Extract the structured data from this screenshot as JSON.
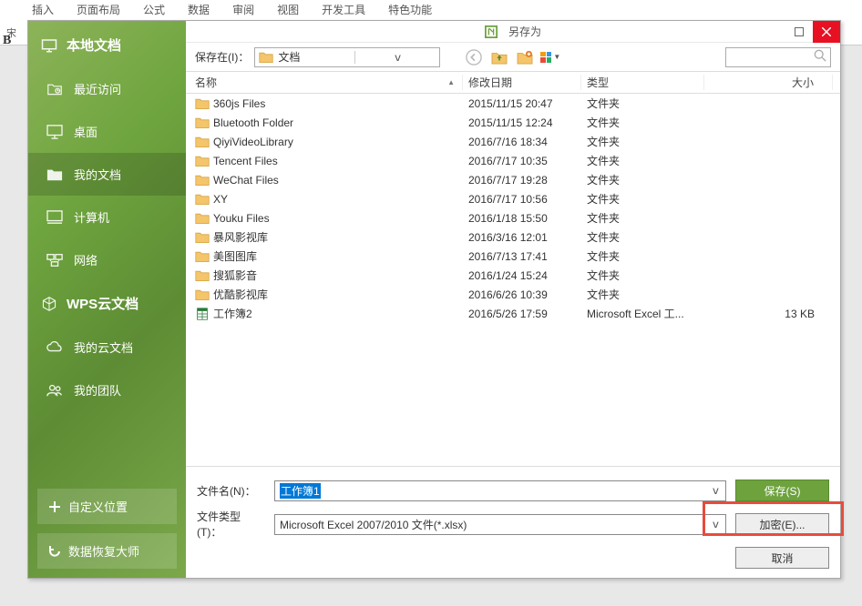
{
  "ribbon": {
    "tabs": [
      "插入",
      "页面布局",
      "公式",
      "数据",
      "审阅",
      "视图",
      "开发工具",
      "特色功能"
    ]
  },
  "dialog": {
    "title": "另存为"
  },
  "sidebar": {
    "header": "本地文档",
    "items": [
      {
        "label": "最近访问",
        "icon": "recent"
      },
      {
        "label": "桌面",
        "icon": "desktop"
      },
      {
        "label": "我的文档",
        "icon": "folder",
        "active": true
      },
      {
        "label": "计算机",
        "icon": "computer"
      },
      {
        "label": "网络",
        "icon": "network"
      }
    ],
    "section2_header": "WPS云文档",
    "section2_items": [
      {
        "label": "我的云文档",
        "icon": "cloud-doc"
      },
      {
        "label": "我的团队",
        "icon": "team"
      }
    ],
    "custom_location_btn": "自定义位置",
    "data_recovery_btn": "数据恢复大师"
  },
  "toolbar": {
    "save_in_label": "保存在(I)：",
    "location": "文档"
  },
  "columns": {
    "name": "名称",
    "date": "修改日期",
    "type": "类型",
    "size": "大小"
  },
  "files": [
    {
      "name": "360js Files",
      "date": "2015/11/15 20:47",
      "type": "文件夹",
      "size": "",
      "kind": "folder"
    },
    {
      "name": "Bluetooth Folder",
      "date": "2015/11/15 12:24",
      "type": "文件夹",
      "size": "",
      "kind": "folder"
    },
    {
      "name": "QiyiVideoLibrary",
      "date": "2016/7/16 18:34",
      "type": "文件夹",
      "size": "",
      "kind": "folder"
    },
    {
      "name": "Tencent Files",
      "date": "2016/7/17 10:35",
      "type": "文件夹",
      "size": "",
      "kind": "folder"
    },
    {
      "name": "WeChat Files",
      "date": "2016/7/17 19:28",
      "type": "文件夹",
      "size": "",
      "kind": "folder"
    },
    {
      "name": "XY",
      "date": "2016/7/17 10:56",
      "type": "文件夹",
      "size": "",
      "kind": "folder"
    },
    {
      "name": "Youku Files",
      "date": "2016/1/18 15:50",
      "type": "文件夹",
      "size": "",
      "kind": "folder"
    },
    {
      "name": "暴风影视库",
      "date": "2016/3/16 12:01",
      "type": "文件夹",
      "size": "",
      "kind": "folder"
    },
    {
      "name": "美图图库",
      "date": "2016/7/13 17:41",
      "type": "文件夹",
      "size": "",
      "kind": "folder"
    },
    {
      "name": "搜狐影音",
      "date": "2016/1/24 15:24",
      "type": "文件夹",
      "size": "",
      "kind": "folder"
    },
    {
      "name": "优酷影视库",
      "date": "2016/6/26 10:39",
      "type": "文件夹",
      "size": "",
      "kind": "folder"
    },
    {
      "name": "工作簿2",
      "date": "2016/5/26 17:59",
      "type": "Microsoft Excel 工...",
      "size": "13 KB",
      "kind": "xlsx"
    }
  ],
  "bottom": {
    "filename_label": "文件名(N)：",
    "filename_value": "工作簿1",
    "filetype_label": "文件类型(T)：",
    "filetype_value": "Microsoft Excel 2007/2010 文件(*.xlsx)",
    "save_btn": "保存(S)",
    "encrypt_btn": "加密(E)...",
    "cancel_btn": "取消"
  }
}
